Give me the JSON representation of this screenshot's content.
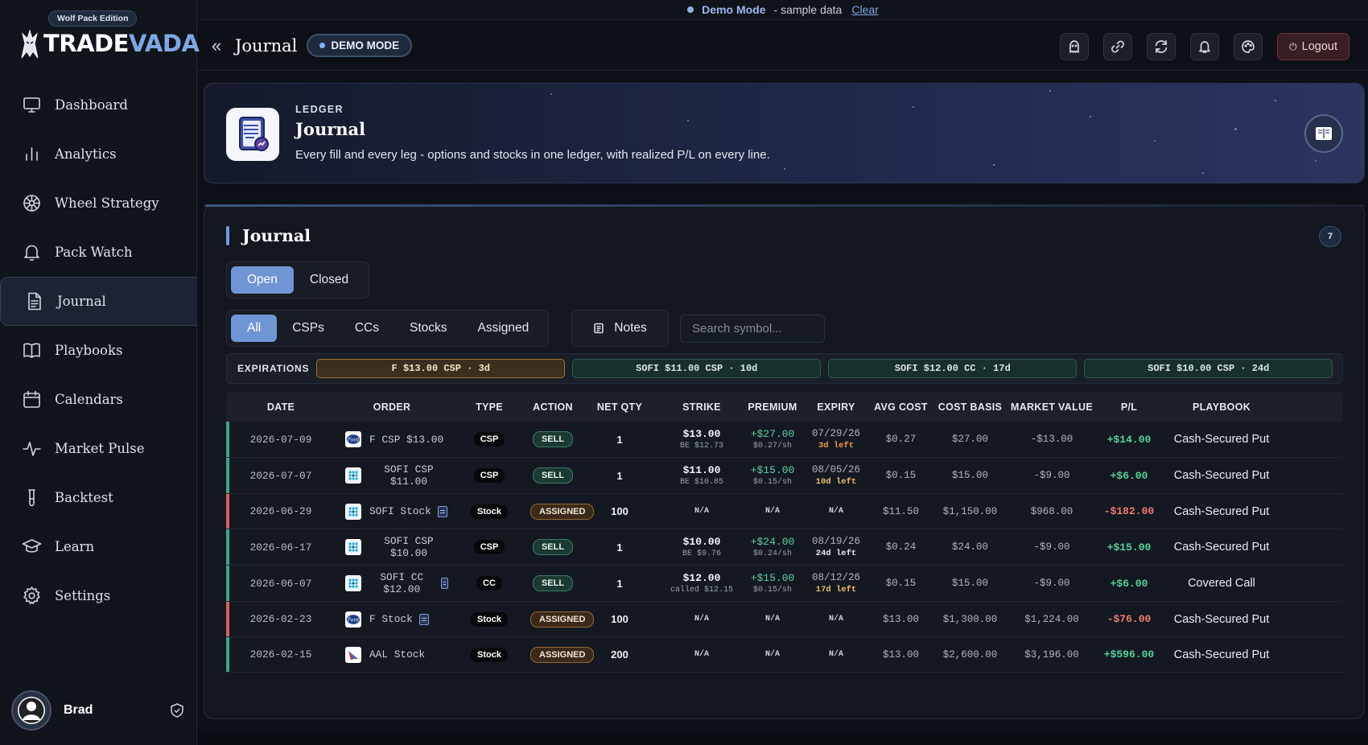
{
  "brand": {
    "edition": "Wolf Pack Edition",
    "name_a": "TRADE",
    "name_b": "VADA"
  },
  "nav": [
    {
      "label": "Dashboard",
      "icon": "monitor-icon"
    },
    {
      "label": "Analytics",
      "icon": "bar-chart-icon"
    },
    {
      "label": "Wheel Strategy",
      "icon": "wheel-icon"
    },
    {
      "label": "Pack Watch",
      "icon": "bell-icon"
    },
    {
      "label": "Journal",
      "icon": "document-icon",
      "active": true
    },
    {
      "label": "Playbooks",
      "icon": "book-icon"
    },
    {
      "label": "Calendars",
      "icon": "calendar-icon"
    },
    {
      "label": "Market Pulse",
      "icon": "pulse-icon"
    },
    {
      "label": "Backtest",
      "icon": "test-tube-icon"
    },
    {
      "label": "Learn",
      "icon": "graduation-cap-icon"
    },
    {
      "label": "Settings",
      "icon": "gear-icon"
    }
  ],
  "user": {
    "name": "Brad"
  },
  "demobar": {
    "mode": "Demo Mode",
    "sample": "- sample data",
    "clear": "Clear"
  },
  "header": {
    "title": "Journal",
    "demo_pill": "DEMO MODE",
    "logout": "Logout"
  },
  "hero": {
    "label": "LEDGER",
    "title": "Journal",
    "description": "Every fill and every leg - options and stocks in one ledger, with realized P/L on every line."
  },
  "panel": {
    "title": "Journal",
    "count": "7",
    "status_tabs": [
      "Open",
      "Closed"
    ],
    "filters": [
      "All",
      "CSPs",
      "CCs",
      "Stocks",
      "Assigned"
    ],
    "notes": "Notes",
    "search_placeholder": "Search symbol...",
    "expirations_label": "EXPIRATIONS",
    "expirations": [
      {
        "text": "F $13.00 CSP · 3d",
        "status": "warn"
      },
      {
        "text": "SOFI $11.00 CSP · 10d",
        "status": "ok"
      },
      {
        "text": "SOFI $12.00 CC · 17d",
        "status": "ok"
      },
      {
        "text": "SOFI $10.00 CSP · 24d",
        "status": "ok"
      }
    ]
  },
  "table": {
    "columns": [
      "DATE",
      "ORDER",
      "TYPE",
      "ACTION",
      "NET QTY",
      "STRIKE",
      "PREMIUM",
      "EXPIRY",
      "AVG COST",
      "COST BASIS",
      "MARKET VALUE",
      "P/L",
      "PLAYBOOK"
    ],
    "rows": [
      {
        "date": "2026-07-09",
        "logo": "F",
        "order": "F CSP $13.00",
        "note": false,
        "type": "CSP",
        "action": "SELL",
        "qty": "1",
        "strike": "$13.00",
        "strike_sub": "BE $12.73",
        "premium": "+$27.00",
        "premium_sub": "$0.27/sh",
        "expiry": "07/29/26",
        "expiry_left": "3d left",
        "left_color": "orange",
        "avg": "$0.27",
        "basis": "$27.00",
        "mv": "-$13.00",
        "pl": "+$14.00",
        "pl_sign": "pos",
        "playbook": "Cash-Secured Put",
        "edge": "#3aa886"
      },
      {
        "date": "2026-07-07",
        "logo": "SOFI",
        "order": "SOFI CSP $11.00",
        "note": false,
        "type": "CSP",
        "action": "SELL",
        "qty": "1",
        "strike": "$11.00",
        "strike_sub": "BE $10.85",
        "premium": "+$15.00",
        "premium_sub": "$0.15/sh",
        "expiry": "08/05/26",
        "expiry_left": "10d left",
        "left_color": "amber",
        "avg": "$0.15",
        "basis": "$15.00",
        "mv": "-$9.00",
        "pl": "+$6.00",
        "pl_sign": "pos",
        "playbook": "Cash-Secured Put",
        "edge": "#3aa886"
      },
      {
        "date": "2026-06-29",
        "logo": "SOFI",
        "order": "SOFI Stock",
        "note": true,
        "type": "Stock",
        "action": "ASSIGNED",
        "qty": "100",
        "strike": "N/A",
        "strike_sub": "",
        "premium": "N/A",
        "premium_sub": "",
        "expiry": "N/A",
        "expiry_left": "",
        "left_color": "",
        "avg": "$11.50",
        "basis": "$1,150.00",
        "mv": "$968.00",
        "pl": "-$182.00",
        "pl_sign": "neg",
        "playbook": "Cash-Secured Put",
        "edge": "#d9605a"
      },
      {
        "date": "2026-06-17",
        "logo": "SOFI",
        "order": "SOFI CSP $10.00",
        "note": false,
        "type": "CSP",
        "action": "SELL",
        "qty": "1",
        "strike": "$10.00",
        "strike_sub": "BE $9.76",
        "premium": "+$24.00",
        "premium_sub": "$0.24/sh",
        "expiry": "08/19/26",
        "expiry_left": "24d left",
        "left_color": "white",
        "avg": "$0.24",
        "basis": "$24.00",
        "mv": "-$9.00",
        "pl": "+$15.00",
        "pl_sign": "pos",
        "playbook": "Cash-Secured Put",
        "edge": "#3aa886"
      },
      {
        "date": "2026-06-07",
        "logo": "SOFI",
        "order": "SOFI CC $12.00",
        "note": true,
        "type": "CC",
        "action": "SELL",
        "qty": "1",
        "strike": "$12.00",
        "strike_sub": "called $12.15",
        "premium": "+$15.00",
        "premium_sub": "$0.15/sh",
        "expiry": "08/12/26",
        "expiry_left": "17d left",
        "left_color": "amber",
        "avg": "$0.15",
        "basis": "$15.00",
        "mv": "-$9.00",
        "pl": "+$6.00",
        "pl_sign": "pos",
        "playbook": "Covered Call",
        "edge": "#3aa886"
      },
      {
        "date": "2026-02-23",
        "logo": "F",
        "order": "F Stock",
        "note": true,
        "type": "Stock",
        "action": "ASSIGNED",
        "qty": "100",
        "strike": "N/A",
        "strike_sub": "",
        "premium": "N/A",
        "premium_sub": "",
        "expiry": "N/A",
        "expiry_left": "",
        "left_color": "",
        "avg": "$13.00",
        "basis": "$1,300.00",
        "mv": "$1,224.00",
        "pl": "-$76.00",
        "pl_sign": "neg",
        "playbook": "Cash-Secured Put",
        "edge": "#d9605a"
      },
      {
        "date": "2026-02-15",
        "logo": "AAL",
        "order": "AAL Stock",
        "note": false,
        "type": "Stock",
        "action": "ASSIGNED",
        "qty": "200",
        "strike": "N/A",
        "strike_sub": "",
        "premium": "N/A",
        "premium_sub": "",
        "expiry": "N/A",
        "expiry_left": "",
        "left_color": "",
        "avg": "$13.00",
        "basis": "$2,600.00",
        "mv": "$3,196.00",
        "pl": "+$596.00",
        "pl_sign": "pos",
        "playbook": "Cash-Secured Put",
        "edge": "#3aa886"
      }
    ]
  }
}
